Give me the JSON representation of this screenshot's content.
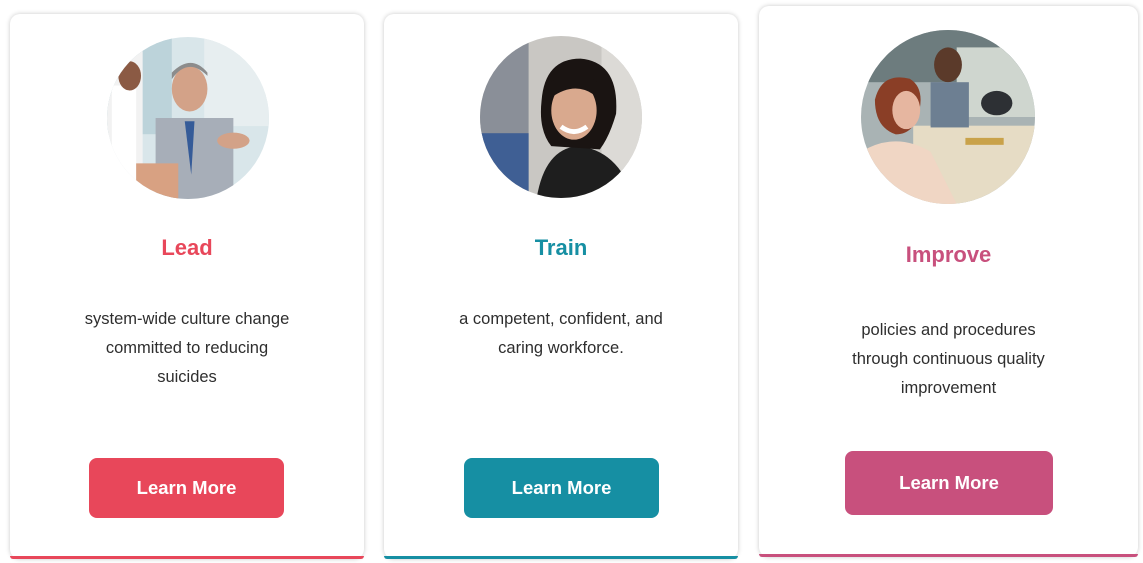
{
  "colors": {
    "lead": "#e8475a",
    "train": "#168fa3",
    "improve": "#c8507d"
  },
  "cards": [
    {
      "title": "Lead",
      "line1": "system-wide culture change",
      "line2": "committed to reducing",
      "line3": "suicides",
      "button": "Learn More",
      "image": "meeting-photo"
    },
    {
      "title": "Train",
      "line1": "a competent, confident, and",
      "line2": "caring workforce.",
      "button": "Learn More",
      "image": "smiling-woman-photo"
    },
    {
      "title": "Improve",
      "line1": "policies and procedures",
      "line2": "through continuous quality",
      "line3": "improvement",
      "button": "Learn More",
      "image": "team-meeting-photo"
    }
  ]
}
